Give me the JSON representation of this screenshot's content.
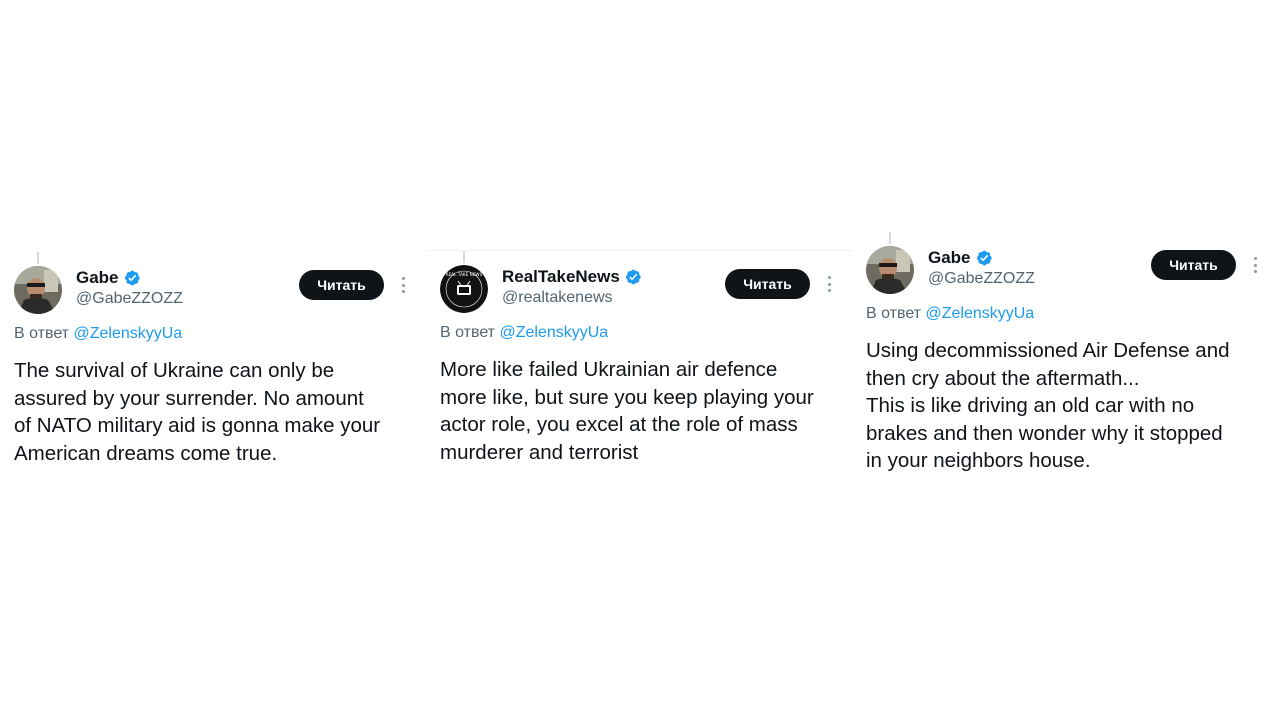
{
  "tweets": [
    {
      "display_name": "Gabe",
      "handle": "@GabeZZOZZ",
      "follow_label": "Читать",
      "reply_prefix": "В ответ",
      "reply_mention": "@ZelenskyyUa",
      "text_lines": [
        "The survival of Ukraine can only be",
        "assured by your surrender. No amount",
        "of NATO military aid is gonna make your",
        "American dreams come true."
      ],
      "avatar_icon": "profile-photo-icon",
      "verified_icon": "verified-badge-icon"
    },
    {
      "display_name": "RealTakeNews",
      "handle": "@realtakenews",
      "follow_label": "Читать",
      "reply_prefix": "В ответ",
      "reply_mention": "@ZelenskyyUa",
      "text_lines": [
        "More like failed Ukrainian air defence",
        "more like, but sure you keep playing your",
        "actor role, you excel at the role of mass",
        "murderer and terrorist"
      ],
      "avatar_icon": "realtakenews-logo-icon",
      "avatar_logo_text": "REAL TAKE NEWS",
      "verified_icon": "verified-badge-icon"
    },
    {
      "display_name": "Gabe",
      "handle": "@GabeZZOZZ",
      "follow_label": "Читать",
      "reply_prefix": "В ответ",
      "reply_mention": "@ZelenskyyUa",
      "text_lines": [
        "Using decommissioned Air Defense and",
        "then cry about the aftermath...",
        "This is like driving an old car with no",
        "brakes and then wonder why it stopped",
        "in your neighbors house."
      ],
      "avatar_icon": "profile-photo-icon",
      "verified_icon": "verified-badge-icon"
    }
  ],
  "colors": {
    "text": "#0f1419",
    "secondary": "#536471",
    "link": "#1d9bf0",
    "verified": "#1d9bf0",
    "button_bg": "#0f1419",
    "button_text": "#ffffff"
  }
}
